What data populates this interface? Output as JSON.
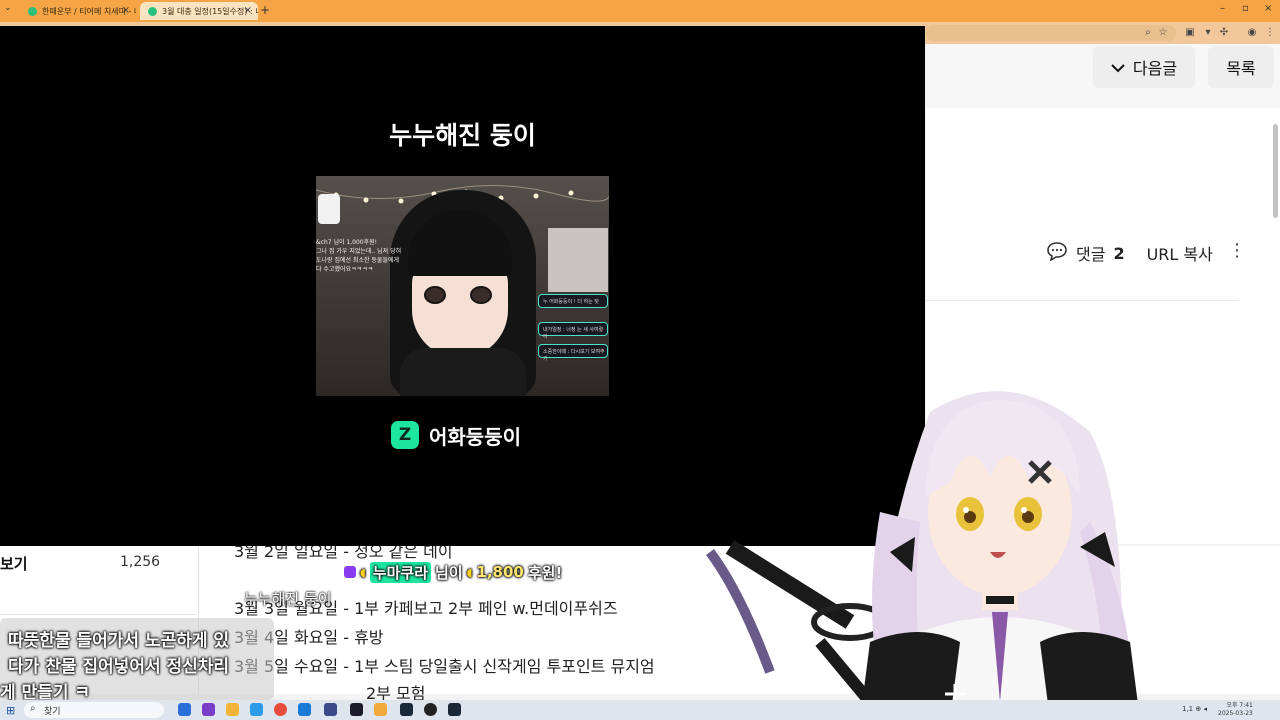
{
  "browser": {
    "tabs": [
      {
        "title": "한때운부 / 티어메 치세미 - 내"
      },
      {
        "title": "3월 대충 일정(15일수정) : 네이"
      }
    ],
    "new_tab": "+",
    "tab_close": "×",
    "window_controls": [
      "–",
      "▫",
      "×"
    ]
  },
  "page_nav": {
    "next_post": "다음글",
    "list": "목록"
  },
  "post_actions": {
    "comment_label": "댓글",
    "comment_count": "2",
    "url_copy": "URL 복사"
  },
  "alert_overlay": {
    "donor_title": "누누해진 둥이",
    "channel_name": "어화둥둥이",
    "stream_chat": [
      "&ch7 님이 1,000후원!",
      "그나 집 가우 지었는데.. 님져 당혀",
      "도나랑 집에선 최소한 동물들에게",
      "다 수고했어요ㅋㅋㅋㅋ"
    ],
    "stream_cards": [
      "누 어화둥둥이 ! 더 하는 탓",
      "내가일정 : 너정 는 새 사여렸어",
      "소중한이때 : 다시보기 보여주기"
    ]
  },
  "sidebar": {
    "label": "보기",
    "count": "1,256"
  },
  "post_body": {
    "lines": [
      "3월 2일 일요일 - 정오 같은 데이",
      "3월 3일 월요일 - 1부 카페보고 2부 페인 w.먼데이푸쉬즈",
      "3월 4일 화요일 - 휴방",
      "3월 5일 수요일 - 1부 스팀 당일출시 신작게임 투포인트 뮤지엄",
      "2부 모험"
    ]
  },
  "donation_alert": {
    "donor": "누마쿠라",
    "suffix": "님이",
    "amount": "1,800",
    "amount_suffix": "후원!",
    "echo": "누누해진 둥이"
  },
  "chat_message": {
    "lines": [
      "따뜻한물 들어가서 노곤하게 있",
      "다가 찬물 집어넣어서 정신차리",
      "게 만들기 ㅋ"
    ]
  },
  "taskbar": {
    "search_placeholder": "찾기",
    "tray": "1,1 ⊕ ◂",
    "clock_time": "오후 7:41",
    "clock_date": "2025-03-23"
  },
  "colors": {
    "tab_strip": "#f5a546",
    "address_bar": "#f2c89a",
    "overlay_bg": "#000000",
    "channel_logo": "#1ee6a0",
    "donation_heart": "#8a3cf0"
  }
}
